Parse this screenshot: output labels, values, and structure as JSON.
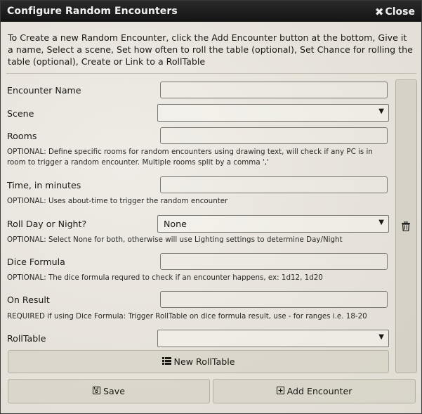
{
  "window": {
    "title": "Configure Random Encounters",
    "close_label": "Close"
  },
  "intro": "To Create a new Random Encounter, click the Add Encounter button at the bottom, Give it a name, Select a scene, Set how often to roll the table (optional), Set Chance for rolling the table (optional), Create or Link to a RollTable",
  "form": {
    "encounter_name": {
      "label": "Encounter Name",
      "value": ""
    },
    "scene": {
      "label": "Scene",
      "value": ""
    },
    "rooms": {
      "label": "Rooms",
      "value": "",
      "note": "OPTIONAL: Define specific rooms for random encounters using drawing text, will check if any PC is in room to trigger a random encounter. Multiple rooms split by a comma ','"
    },
    "time": {
      "label": "Time, in minutes",
      "value": "",
      "note": "OPTIONAL: Uses about-time to trigger the random encounter"
    },
    "day_night": {
      "label": "Roll Day or Night?",
      "value": "None",
      "note": "OPTIONAL: Select None for both, otherwise will use Lighting settings to determine Day/Night"
    },
    "dice": {
      "label": "Dice Formula",
      "value": "",
      "note": "OPTIONAL: The dice formula requred to check if an encounter happens, ex: 1d12, 1d20"
    },
    "on_result": {
      "label": "On Result",
      "value": "",
      "note": "REQUIRED if using Dice Formula: Trigger RollTable on dice formula result, use - for ranges i.e. 18-20"
    },
    "rolltable": {
      "label": "RollTable",
      "value": ""
    },
    "new_rolltable_label": "New RollTable"
  },
  "footer": {
    "save_label": "Save",
    "add_label": "Add Encounter"
  },
  "icons": {
    "close": "close-icon",
    "trash": "trash-icon",
    "list": "list-icon",
    "save": "floppy-disk-icon",
    "add": "plus-square-icon"
  }
}
